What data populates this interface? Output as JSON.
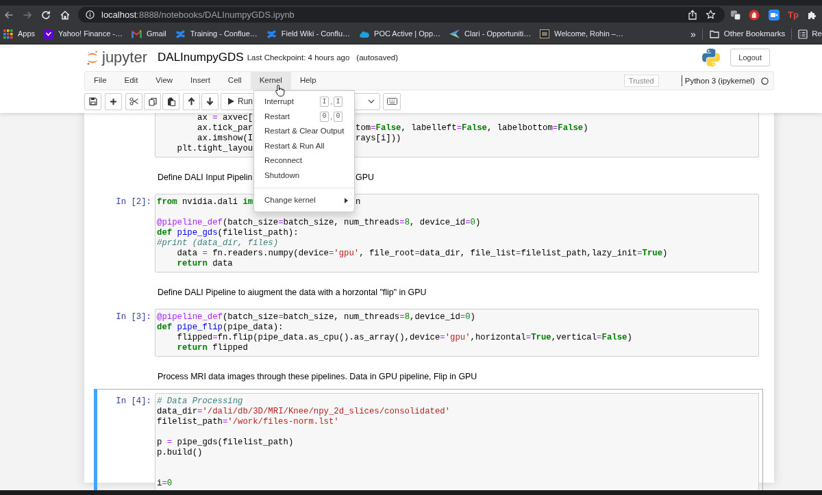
{
  "browser": {
    "url_host": "localhost",
    "url_path": ":8888/notebooks/DALInumpyGDS.ipynb",
    "extension_text": "Tp",
    "bookmarks": [
      {
        "label": "Apps"
      },
      {
        "label": "Yahoo! Finance -…"
      },
      {
        "label": "Gmail"
      },
      {
        "label": "Training - Conflue…"
      },
      {
        "label": "Field Wiki - Conflu…"
      },
      {
        "label": "POC Active | Opp…"
      },
      {
        "label": "Clari - Opportuniti…"
      },
      {
        "label": "Welcome, Rohin –…"
      }
    ],
    "overflow": "»",
    "other_bookmarks": "Other Bookmarks",
    "reading_list": "Re"
  },
  "header": {
    "logo_text": "jupyter",
    "notebook_name": "DALInumpyGDS",
    "checkpoint": "Last Checkpoint: 4 hours ago",
    "save_status": "(autosaved)",
    "logout": "Logout"
  },
  "menubar": {
    "menus": [
      {
        "label": "File",
        "open": false
      },
      {
        "label": "Edit",
        "open": false
      },
      {
        "label": "View",
        "open": false
      },
      {
        "label": "Insert",
        "open": false
      },
      {
        "label": "Cell",
        "open": false
      },
      {
        "label": "Kernel",
        "open": true
      },
      {
        "label": "Help",
        "open": false
      }
    ],
    "trusted": "Trusted",
    "kernel_name": "Python 3 (ipykernel)",
    "kernel_busy": false
  },
  "toolbar": {
    "run_label": "Run"
  },
  "kernel_menu": {
    "items": [
      {
        "kind": "item",
        "label": "Interrupt",
        "shortcut": {
          "keys": [
            "I",
            "I"
          ],
          "separator": ","
        },
        "submenu": false
      },
      {
        "kind": "item",
        "label": "Restart",
        "shortcut": {
          "keys": [
            "0",
            "0"
          ],
          "separator": ","
        },
        "submenu": false
      },
      {
        "kind": "item",
        "label": "Restart & Clear Output",
        "submenu": false
      },
      {
        "kind": "item",
        "label": "Restart & Run All",
        "submenu": false
      },
      {
        "kind": "item",
        "label": "Reconnect",
        "submenu": false
      },
      {
        "kind": "item",
        "label": "Shutdown",
        "submenu": false
      },
      {
        "kind": "divider"
      },
      {
        "kind": "item",
        "label": "Change kernel",
        "submenu": true
      }
    ]
  },
  "notebook": {
    "cells": [
      {
        "kind": "code",
        "selected": false,
        "lines": [
          {
            "kind": "code",
            "pieces": [
              [
                {
                  "kind": "plain",
                  "text": "        ax "
                },
                {
                  "kind": "op",
                  "text": "="
                },
                {
                  "kind": "plain",
                  "text": " axvec["
                }
              ]
            ]
          },
          {
            "kind": "code",
            "pieces": [
              [
                {
                  "kind": "plain",
                  "text": "        ax.tick_par"
                }
              ],
              [
                {
                  "kind": "plain",
                  "text": "tom"
                },
                {
                  "kind": "op",
                  "text": "="
                },
                {
                  "kind": "kw",
                  "text": "False"
                },
                {
                  "kind": "plain",
                  "text": ", labelleft"
                },
                {
                  "kind": "op",
                  "text": "="
                },
                {
                  "kind": "kw",
                  "text": "False"
                },
                {
                  "kind": "plain",
                  "text": ", labelbottom"
                },
                {
                  "kind": "op",
                  "text": "="
                },
                {
                  "kind": "kw",
                  "text": "False"
                },
                {
                  "kind": "plain",
                  "text": ")"
                }
              ]
            ]
          },
          {
            "kind": "code",
            "pieces": [
              [
                {
                  "kind": "plain",
                  "text": "        ax.imshow(I"
                }
              ],
              [
                {
                  "kind": "plain",
                  "text": "rays[i]))"
                }
              ]
            ]
          },
          {
            "kind": "code",
            "pieces": [
              [
                {
                  "kind": "plain",
                  "text": "    plt.tight_layou"
                }
              ]
            ]
          }
        ]
      },
      {
        "kind": "markdown",
        "selected": false,
        "pieces": [
          "Define DALI Input Pipelin",
          "GPU"
        ]
      },
      {
        "kind": "code",
        "selected": false,
        "prompt": "In [2]:",
        "lines": [
          {
            "kind": "code",
            "pieces": [
              [
                {
                  "kind": "kw",
                  "text": "from"
                },
                {
                  "kind": "plain",
                  "text": " nvidia.dali "
                },
                {
                  "kind": "kw",
                  "text": "im"
                }
              ],
              [
                {
                  "kind": "plain",
                  "text": "n"
                }
              ]
            ]
          },
          {
            "kind": "blank"
          },
          {
            "kind": "code",
            "pieces": [
              [
                {
                  "kind": "deco",
                  "text": "@pipeline_def"
                },
                {
                  "kind": "plain",
                  "text": "(batch_size"
                },
                {
                  "kind": "op",
                  "text": "="
                },
                {
                  "kind": "plain",
                  "text": "batch_size, num_threads"
                },
                {
                  "kind": "op",
                  "text": "="
                },
                {
                  "kind": "num",
                  "text": "8"
                },
                {
                  "kind": "plain",
                  "text": ", device_id"
                },
                {
                  "kind": "op",
                  "text": "="
                },
                {
                  "kind": "num",
                  "text": "0"
                },
                {
                  "kind": "plain",
                  "text": ")"
                }
              ]
            ]
          },
          {
            "kind": "code",
            "pieces": [
              [
                {
                  "kind": "kw",
                  "text": "def"
                },
                {
                  "kind": "def",
                  "text": " pipe_gds"
                },
                {
                  "kind": "plain",
                  "text": "(filelist_path):"
                }
              ]
            ]
          },
          {
            "kind": "code",
            "pieces": [
              [
                {
                  "kind": "comment",
                  "text": "#print (data_dir, files)"
                }
              ]
            ]
          },
          {
            "kind": "code",
            "pieces": [
              [
                {
                  "kind": "plain",
                  "text": "    data "
                },
                {
                  "kind": "op",
                  "text": "="
                },
                {
                  "kind": "plain",
                  "text": " fn.readers.numpy(device"
                },
                {
                  "kind": "op",
                  "text": "="
                },
                {
                  "kind": "str",
                  "text": "'gpu'"
                },
                {
                  "kind": "plain",
                  "text": ", file_root"
                },
                {
                  "kind": "op",
                  "text": "="
                },
                {
                  "kind": "plain",
                  "text": "data_dir, file_list"
                },
                {
                  "kind": "op",
                  "text": "="
                },
                {
                  "kind": "plain",
                  "text": "filelist_path,lazy_init"
                },
                {
                  "kind": "op",
                  "text": "="
                },
                {
                  "kind": "kw",
                  "text": "True"
                },
                {
                  "kind": "plain",
                  "text": ")"
                }
              ]
            ]
          },
          {
            "kind": "code",
            "pieces": [
              [
                {
                  "kind": "kw",
                  "text": "    return"
                },
                {
                  "kind": "plain",
                  "text": " data"
                }
              ]
            ]
          }
        ]
      },
      {
        "kind": "markdown",
        "selected": false,
        "pieces": [
          "Define DALI Pipeline to aiugment the data with a horzontal \"flip\" in GPU"
        ]
      },
      {
        "kind": "code",
        "selected": false,
        "prompt": "In [3]:",
        "lines": [
          {
            "kind": "code",
            "pieces": [
              [
                {
                  "kind": "deco",
                  "text": "@pipeline_def"
                },
                {
                  "kind": "plain",
                  "text": "(batch_size"
                },
                {
                  "kind": "op",
                  "text": "="
                },
                {
                  "kind": "plain",
                  "text": "batch_size, num_threads"
                },
                {
                  "kind": "op",
                  "text": "="
                },
                {
                  "kind": "num",
                  "text": "8"
                },
                {
                  "kind": "plain",
                  "text": ",device_id"
                },
                {
                  "kind": "op",
                  "text": "="
                },
                {
                  "kind": "num",
                  "text": "0"
                },
                {
                  "kind": "plain",
                  "text": ")"
                }
              ]
            ]
          },
          {
            "kind": "code",
            "pieces": [
              [
                {
                  "kind": "kw",
                  "text": "def"
                },
                {
                  "kind": "def",
                  "text": " pipe_flip"
                },
                {
                  "kind": "plain",
                  "text": "(pipe_data):"
                }
              ]
            ]
          },
          {
            "kind": "code",
            "pieces": [
              [
                {
                  "kind": "plain",
                  "text": "    flipped"
                },
                {
                  "kind": "op",
                  "text": "="
                },
                {
                  "kind": "plain",
                  "text": "fn.flip(pipe_data.as_cpu().as_array(),device"
                },
                {
                  "kind": "op",
                  "text": "="
                },
                {
                  "kind": "str",
                  "text": "'gpu'"
                },
                {
                  "kind": "plain",
                  "text": ",horizontal"
                },
                {
                  "kind": "op",
                  "text": "="
                },
                {
                  "kind": "kw",
                  "text": "True"
                },
                {
                  "kind": "plain",
                  "text": ",vertical"
                },
                {
                  "kind": "op",
                  "text": "="
                },
                {
                  "kind": "kw",
                  "text": "False"
                },
                {
                  "kind": "plain",
                  "text": ")"
                }
              ]
            ]
          },
          {
            "kind": "code",
            "pieces": [
              [
                {
                  "kind": "kw",
                  "text": "    return"
                },
                {
                  "kind": "plain",
                  "text": " flipped"
                }
              ]
            ]
          }
        ]
      },
      {
        "kind": "markdown",
        "selected": false,
        "pieces": [
          "Process MRI data images through these pipelines. Data in GPU pipeline, Flip in GPU"
        ]
      },
      {
        "kind": "code",
        "selected": true,
        "prompt": "In [4]:",
        "lines": [
          {
            "kind": "code",
            "pieces": [
              [
                {
                  "kind": "comment",
                  "text": "# Data Processing"
                }
              ]
            ]
          },
          {
            "kind": "code",
            "pieces": [
              [
                {
                  "kind": "plain",
                  "text": "data_dir"
                },
                {
                  "kind": "op",
                  "text": "="
                },
                {
                  "kind": "str",
                  "text": "'/dali/db/3D/MRI/Knee/npy_2d_slices/consolidated'"
                }
              ]
            ]
          },
          {
            "kind": "code",
            "pieces": [
              [
                {
                  "kind": "plain",
                  "text": "filelist_path"
                },
                {
                  "kind": "op",
                  "text": "="
                },
                {
                  "kind": "str",
                  "text": "'/work/files-norm.lst'"
                }
              ]
            ]
          },
          {
            "kind": "blank"
          },
          {
            "kind": "code",
            "pieces": [
              [
                {
                  "kind": "plain",
                  "text": "p "
                },
                {
                  "kind": "op",
                  "text": "="
                },
                {
                  "kind": "plain",
                  "text": " pipe_gds(filelist_path)"
                }
              ]
            ]
          },
          {
            "kind": "code",
            "pieces": [
              [
                {
                  "kind": "plain",
                  "text": "p.build()"
                }
              ]
            ]
          },
          {
            "kind": "blank"
          },
          {
            "kind": "blank"
          },
          {
            "kind": "code",
            "pieces": [
              [
                {
                  "kind": "plain",
                  "text": "i"
                },
                {
                  "kind": "op",
                  "text": "="
                },
                {
                  "kind": "num",
                  "text": "0"
                }
              ]
            ]
          }
        ]
      }
    ]
  }
}
